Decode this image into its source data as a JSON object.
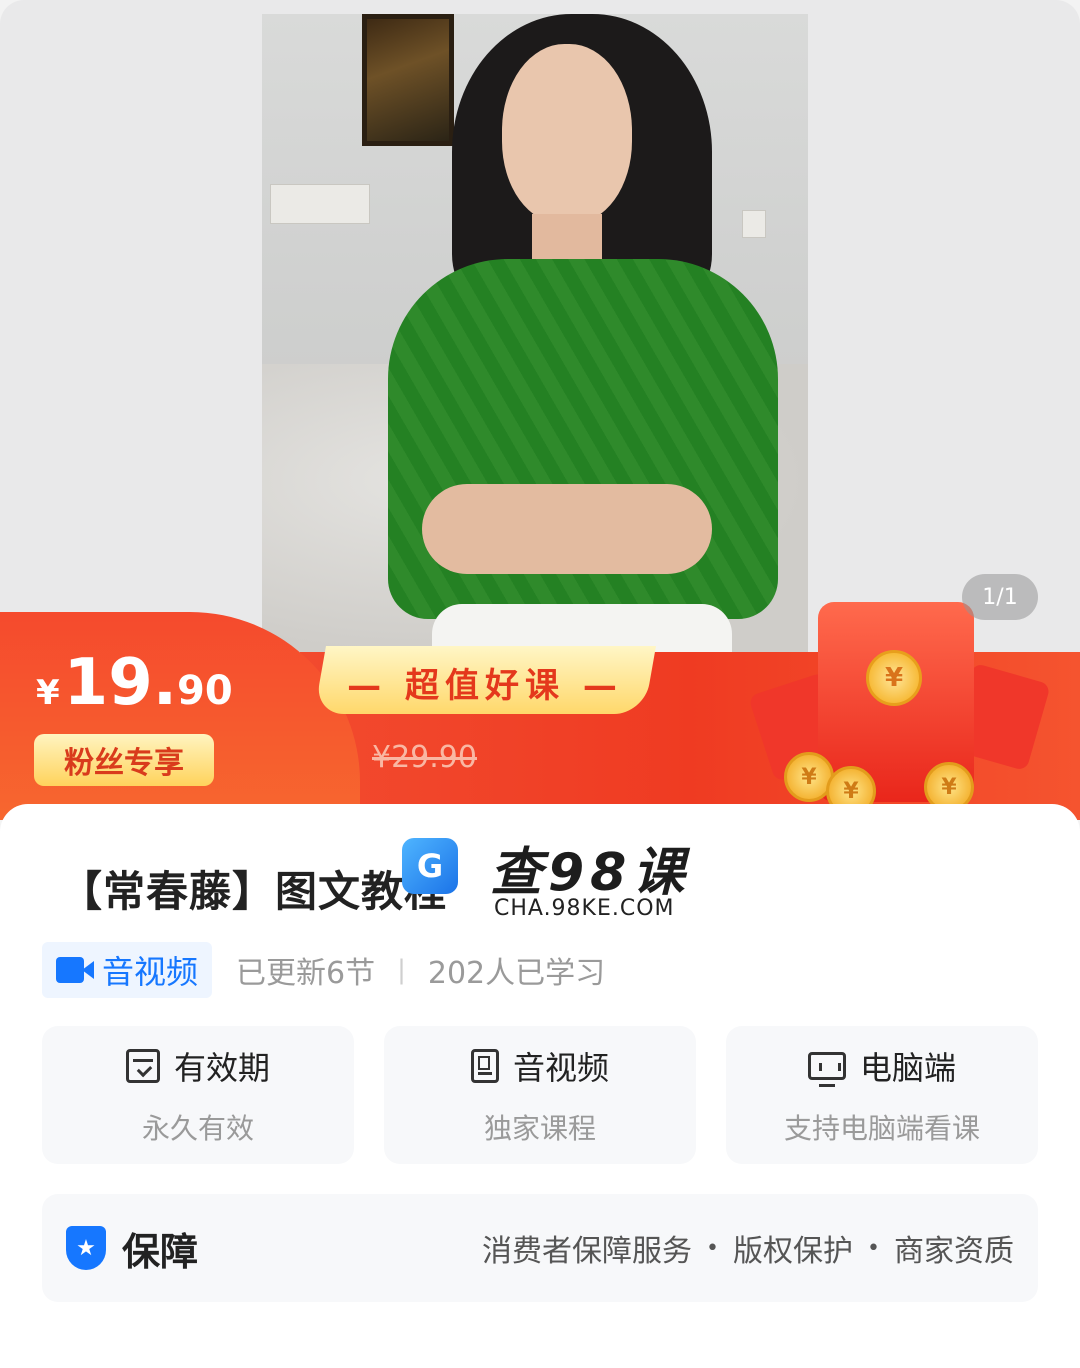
{
  "hero": {
    "image_counter": "1/1"
  },
  "banner": {
    "currency": "¥",
    "price_int": "19.",
    "price_dec": "90",
    "fan_badge": "粉丝专享",
    "ribbon": "— 超值好课 —",
    "old_price": "¥29.90",
    "coin_symbol": "¥"
  },
  "course": {
    "title": "【常春藤】图文教程",
    "type_label": "音视频",
    "updated": "已更新6节",
    "separator": "|",
    "learners": "202人已学习"
  },
  "watermark": {
    "logo_glyph": "G",
    "title": "查98课",
    "url": "CHA.98KE.COM"
  },
  "features": [
    {
      "title": "有效期",
      "sub": "永久有效",
      "icon": "calendar-icon"
    },
    {
      "title": "音视频",
      "sub": "独家课程",
      "icon": "document-icon"
    },
    {
      "title": "电脑端",
      "sub": "支持电脑端看课",
      "icon": "monitor-icon"
    }
  ],
  "guarantee": {
    "title": "保障",
    "items": [
      "消费者保障服务",
      "版权保护",
      "商家资质"
    ],
    "dot": "•"
  },
  "colors": {
    "accent_blue": "#1677ff",
    "promo_red": "#ef3b22",
    "promo_gold": "#ffd86b"
  }
}
